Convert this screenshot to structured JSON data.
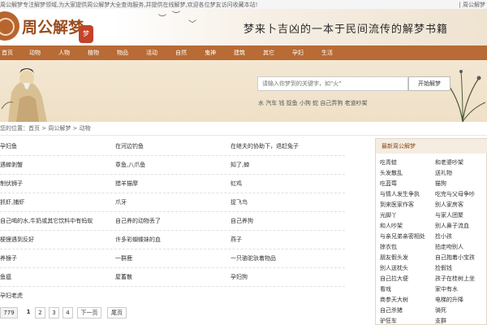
{
  "topbar": {
    "notice": "周公解梦专注解梦领域,为大家提供周公解梦大全查询服务,并提供在线解梦,欢迎各位梦友访问收藏本站!",
    "right": "| 周公解梦"
  },
  "header": {
    "logo_mark": "梦",
    "logo_text": "周公解梦",
    "seal": "梦",
    "slogan": "梦来卜吉凶的一本于民间流传的解梦书籍"
  },
  "nav": {
    "items": [
      "首页",
      "动物",
      "人物",
      "植物",
      "物品",
      "活动",
      "自然",
      "鬼神",
      "建筑",
      "其它",
      "孕妇",
      "生活"
    ]
  },
  "search": {
    "placeholder": "请输入你梦到的关键字，如\"火\"",
    "button": "开始解梦",
    "hot": "水 汽车 钱 捉鱼 小狗 蛇 自己弄狗 老道吵架"
  },
  "breadcrumb": "您的位置：首页 > 周公解梦 > 动物",
  "dream_list": [
    [
      "孕妇鱼",
      "在河边钓鱼",
      "在继夫的协助下，退赶兔子"
    ],
    [
      "遇蝉剥蟹",
      "章鱼,八爪鱼",
      "知了,蝉"
    ],
    [
      "制伏狮子",
      "猎羊猫摩",
      "虹鸡"
    ],
    [
      "抓虾,捕虾",
      "爪牙",
      "捉飞鸟"
    ],
    [
      "自己喝的水,牛奶或其它饮料中有蚂蚁",
      "自己养的动物丢了",
      "自己养狗"
    ],
    [
      "梗狸遇到反好",
      "许多彩蝴蝶妹的血",
      "燕子"
    ],
    [
      "养猴子",
      "一群鹿",
      "一只骆驼驮着物品"
    ],
    [
      "鱼瘟",
      "屋蓄散",
      "孕妇狗"
    ],
    [
      "孕妇老虎",
      "",
      ""
    ]
  ],
  "pager": {
    "total": "779",
    "pages": [
      "1",
      "2",
      "3",
      "4"
    ],
    "next": "下一页",
    "last": "尾页"
  },
  "sidebar": {
    "title": "最新周公解梦",
    "items": [
      [
        "吃青蛙",
        "和老婆吵架"
      ],
      [
        "头发散乱",
        "送礼物"
      ],
      [
        "吃蓝莓",
        "猫狗"
      ],
      [
        "与情人发生争执",
        "吃完与父母争吵"
      ],
      [
        "到来医家作客",
        "别人家房客"
      ],
      [
        "光脚丫",
        "与家人团聚"
      ],
      [
        "和人吵架",
        "别人鼻子流血"
      ],
      [
        "与亲兄弟亲密相处",
        "捡小孩"
      ],
      [
        "掠衣包",
        "拍走吻别人"
      ],
      [
        "朋友假头发",
        "自己抱着小宝孩"
      ],
      [
        "别人送枕头",
        "捡假钱"
      ],
      [
        "自己拉大便",
        "孩子在桂树上坐"
      ],
      [
        "看戏",
        "家中有水"
      ],
      [
        "商参天大树",
        "电梯的升降"
      ],
      [
        "自己杀猪",
        "骑死"
      ],
      [
        "驴狂车",
        "支群"
      ]
    ]
  }
}
